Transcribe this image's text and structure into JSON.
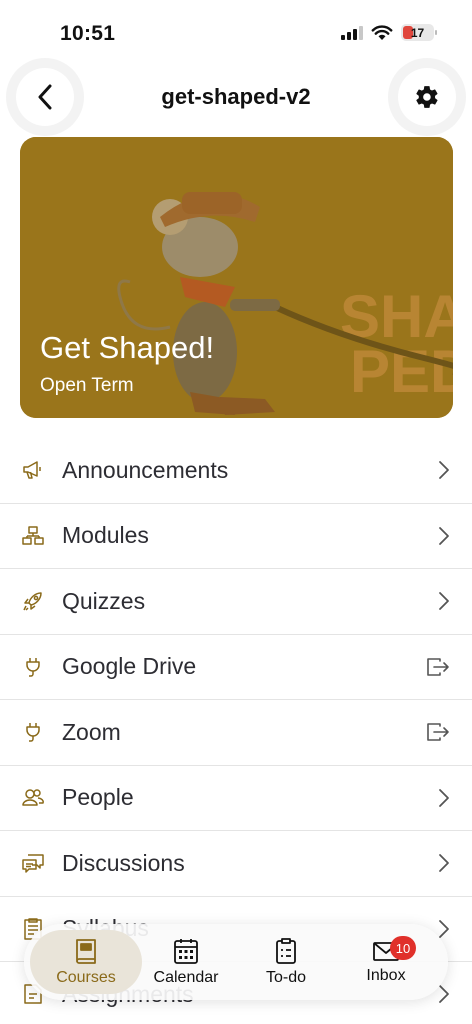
{
  "status": {
    "time": "10:51",
    "battery": "17"
  },
  "header": {
    "title": "get-shaped-v2"
  },
  "hero": {
    "title": "Get Shaped!",
    "subtitle": "Open Term",
    "overlay_color": "#a07a1e"
  },
  "accent": "#8a6a1a",
  "menu": [
    {
      "label": "Announcements",
      "icon": "megaphone-icon",
      "trail": "chevron"
    },
    {
      "label": "Modules",
      "icon": "modules-icon",
      "trail": "chevron"
    },
    {
      "label": "Quizzes",
      "icon": "rocket-icon",
      "trail": "chevron"
    },
    {
      "label": "Google Drive",
      "icon": "plug-icon",
      "trail": "external"
    },
    {
      "label": "Zoom",
      "icon": "plug-icon",
      "trail": "external"
    },
    {
      "label": "People",
      "icon": "people-icon",
      "trail": "chevron"
    },
    {
      "label": "Discussions",
      "icon": "discussions-icon",
      "trail": "chevron"
    },
    {
      "label": "Syllabus",
      "icon": "syllabus-icon",
      "trail": "chevron"
    },
    {
      "label": "Assignments",
      "icon": "assignments-icon",
      "trail": "chevron"
    }
  ],
  "tabs": [
    {
      "label": "Courses",
      "icon": "book-icon",
      "active": true
    },
    {
      "label": "Calendar",
      "icon": "calendar-icon"
    },
    {
      "label": "To-do",
      "icon": "clipboard-icon"
    },
    {
      "label": "Inbox",
      "icon": "envelope-icon",
      "badge": "10"
    }
  ]
}
